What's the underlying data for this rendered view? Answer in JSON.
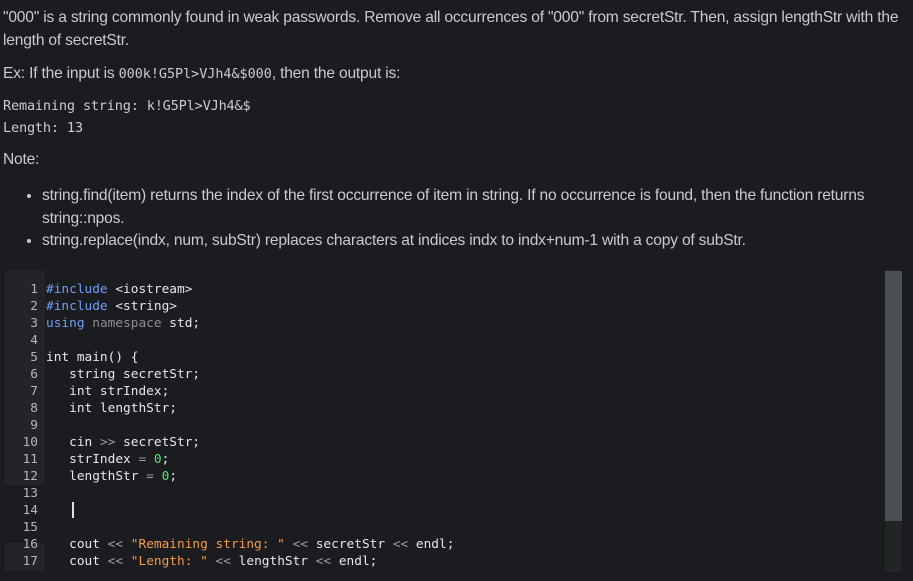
{
  "instructions": {
    "intro": "\"000\" is a string commonly found in weak passwords. Remove all occurrences of \"000\" from secretStr. Then, assign lengthStr with the length of secretStr.",
    "example_prefix": "Ex: If the input is ",
    "example_input": "000k!G5Pl>VJh4&$000",
    "example_suffix": ", then the output is:",
    "sample_output": [
      "Remaining string: k!G5Pl>VJh4&$",
      "Length: 13"
    ],
    "note_label": "Note:",
    "notes": [
      "string.find(item) returns the index of the first occurrence of item in string. If no occurrence is found, then the function returns string::npos.",
      "string.replace(indx, num, subStr) replaces characters at indices indx to indx+num-1 with a copy of subStr."
    ]
  },
  "editor": {
    "active_line": 14,
    "lines": [
      {
        "n": "1",
        "tokens": [
          {
            "t": "#include",
            "c": "kw"
          },
          {
            "t": " <iostream>",
            "c": ""
          }
        ]
      },
      {
        "n": "2",
        "tokens": [
          {
            "t": "#include",
            "c": "kw"
          },
          {
            "t": " <string>",
            "c": ""
          }
        ]
      },
      {
        "n": "3",
        "tokens": [
          {
            "t": "using",
            "c": "kw"
          },
          {
            "t": " ",
            "c": ""
          },
          {
            "t": "namespace",
            "c": "ns"
          },
          {
            "t": " std;",
            "c": ""
          }
        ]
      },
      {
        "n": "4",
        "tokens": []
      },
      {
        "n": "5",
        "tokens": [
          {
            "t": "int main() {",
            "c": ""
          }
        ]
      },
      {
        "n": "6",
        "tokens": [
          {
            "t": "   string secretStr;",
            "c": ""
          }
        ]
      },
      {
        "n": "7",
        "tokens": [
          {
            "t": "   int strIndex;",
            "c": ""
          }
        ]
      },
      {
        "n": "8",
        "tokens": [
          {
            "t": "   int lengthStr;",
            "c": ""
          }
        ]
      },
      {
        "n": "9",
        "tokens": []
      },
      {
        "n": "10",
        "tokens": [
          {
            "t": "   cin ",
            "c": ""
          },
          {
            "t": ">>",
            "c": "op"
          },
          {
            "t": " secretStr;",
            "c": ""
          }
        ]
      },
      {
        "n": "11",
        "tokens": [
          {
            "t": "   strIndex ",
            "c": ""
          },
          {
            "t": "=",
            "c": "op"
          },
          {
            "t": " ",
            "c": ""
          },
          {
            "t": "0",
            "c": "num"
          },
          {
            "t": ";",
            "c": ""
          }
        ]
      },
      {
        "n": "12",
        "tokens": [
          {
            "t": "   lengthStr ",
            "c": ""
          },
          {
            "t": "=",
            "c": "op"
          },
          {
            "t": " ",
            "c": ""
          },
          {
            "t": "0",
            "c": "num"
          },
          {
            "t": ";",
            "c": ""
          }
        ]
      },
      {
        "n": "13",
        "tokens": []
      },
      {
        "n": "14",
        "tokens": [
          {
            "t": "   ",
            "c": "",
            "caret": true
          }
        ]
      },
      {
        "n": "15",
        "tokens": []
      },
      {
        "n": "16",
        "tokens": [
          {
            "t": "   cout ",
            "c": ""
          },
          {
            "t": "<<",
            "c": "op"
          },
          {
            "t": " ",
            "c": ""
          },
          {
            "t": "\"Remaining string: \"",
            "c": "str"
          },
          {
            "t": " ",
            "c": ""
          },
          {
            "t": "<<",
            "c": "op"
          },
          {
            "t": " secretStr ",
            "c": ""
          },
          {
            "t": "<<",
            "c": "op"
          },
          {
            "t": " endl;",
            "c": ""
          }
        ]
      },
      {
        "n": "17",
        "tokens": [
          {
            "t": "   cout ",
            "c": ""
          },
          {
            "t": "<<",
            "c": "op"
          },
          {
            "t": " ",
            "c": ""
          },
          {
            "t": "\"Length: \"",
            "c": "str"
          },
          {
            "t": " ",
            "c": ""
          },
          {
            "t": "<<",
            "c": "op"
          },
          {
            "t": " lengthStr ",
            "c": ""
          },
          {
            "t": "<<",
            "c": "op"
          },
          {
            "t": " endl;",
            "c": ""
          }
        ]
      }
    ]
  }
}
